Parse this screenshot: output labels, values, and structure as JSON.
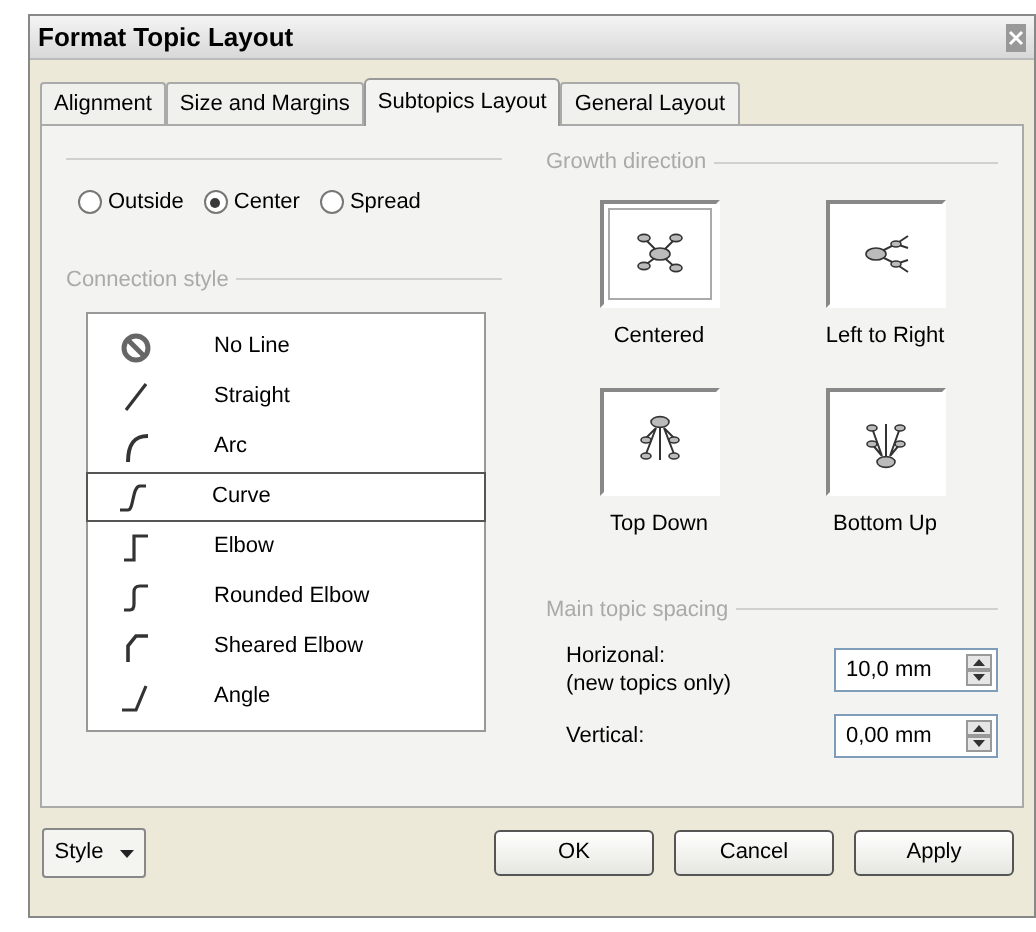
{
  "window": {
    "title": "Format Topic Layout"
  },
  "tabs": [
    {
      "label": "Alignment",
      "selected": false
    },
    {
      "label": "Size and Margins",
      "selected": false
    },
    {
      "label": "Subtopics Layout",
      "selected": true
    },
    {
      "label": "General Layout",
      "selected": false
    }
  ],
  "connection_point": {
    "options": [
      {
        "label": "Outside",
        "selected": false
      },
      {
        "label": "Center",
        "selected": true
      },
      {
        "label": "Spread",
        "selected": false
      }
    ]
  },
  "connection_style": {
    "title": "Connection style",
    "items": [
      {
        "label": "No Line",
        "kind": "none",
        "selected": false
      },
      {
        "label": "Straight",
        "kind": "straight",
        "selected": false
      },
      {
        "label": "Arc",
        "kind": "arc",
        "selected": false
      },
      {
        "label": "Curve",
        "kind": "curve",
        "selected": true
      },
      {
        "label": "Elbow",
        "kind": "elbow",
        "selected": false
      },
      {
        "label": "Rounded Elbow",
        "kind": "rounded",
        "selected": false
      },
      {
        "label": "Sheared Elbow",
        "kind": "sheared",
        "selected": false
      },
      {
        "label": "Angle",
        "kind": "angle",
        "selected": false
      }
    ]
  },
  "growth_direction": {
    "title": "Growth direction",
    "options": [
      {
        "label": "Centered",
        "kind": "centered",
        "selected": true
      },
      {
        "label": "Left to Right",
        "kind": "ltr",
        "selected": false
      },
      {
        "label": "Top Down",
        "kind": "down",
        "selected": false
      },
      {
        "label": "Bottom Up",
        "kind": "up",
        "selected": false
      }
    ]
  },
  "main_topic_spacing": {
    "title": "Main topic spacing",
    "fields": [
      {
        "label": "Horizonal:",
        "note": "(new topics only)",
        "value": "10,0 mm"
      },
      {
        "label": "Vertical:",
        "value": "0,00 mm"
      }
    ]
  },
  "footer": {
    "style_button": "Style",
    "buttons": [
      "OK",
      "Cancel",
      "Apply"
    ]
  }
}
